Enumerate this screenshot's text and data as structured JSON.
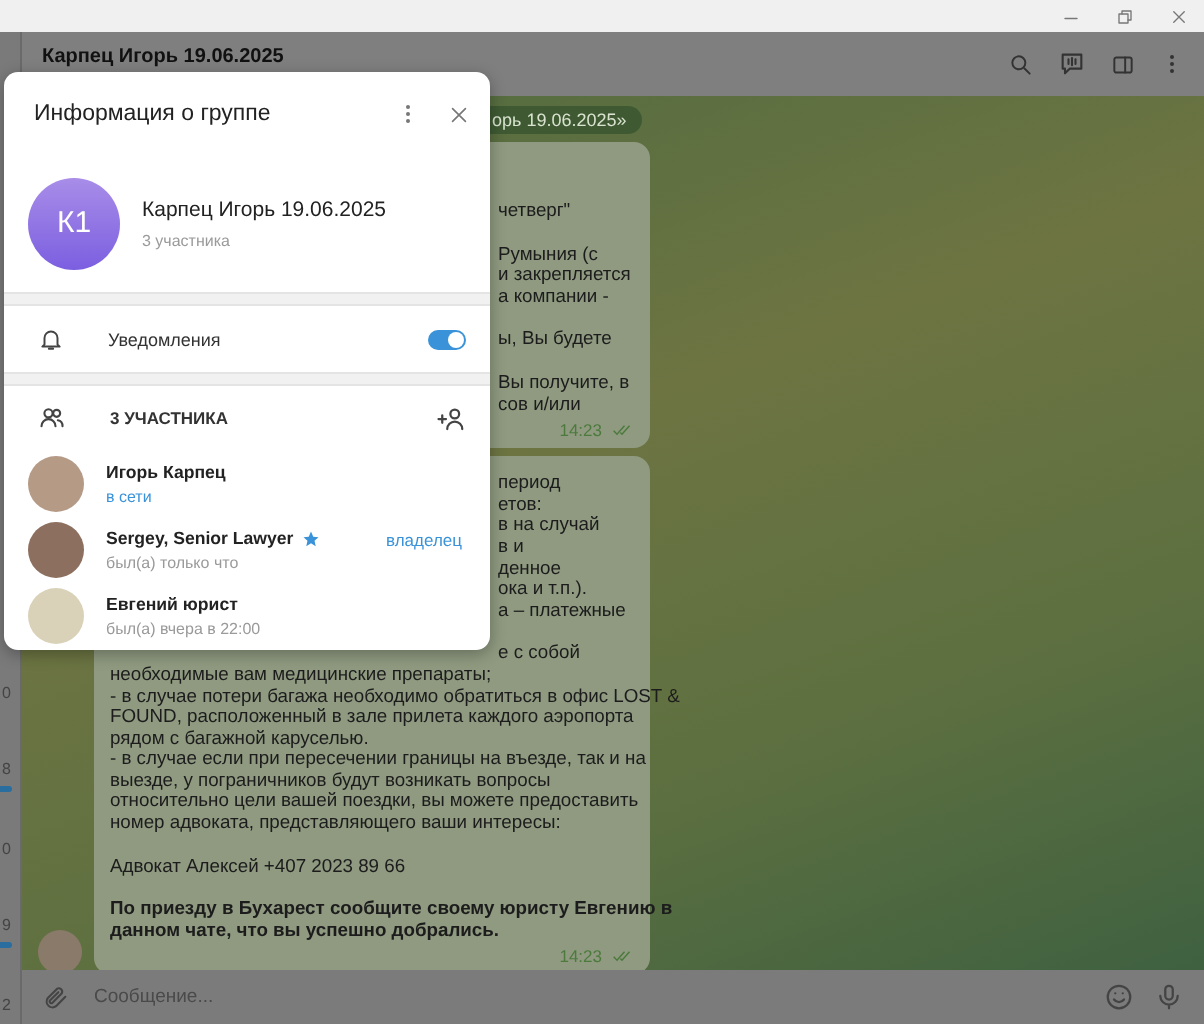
{
  "chat_header": {
    "title": "Карпец Игорь 19.06.2025"
  },
  "sidebar": {
    "items": [
      {
        "text": "0",
        "unread": false
      },
      {
        "text": "8",
        "unread": true
      },
      {
        "text": "0",
        "unread": false
      },
      {
        "text": "9",
        "unread": true
      },
      {
        "text": "2",
        "unread": false
      }
    ]
  },
  "service_message": "орь 19.06.2025»",
  "messages": [
    {
      "time": "14:23",
      "read": true,
      "avatar": false,
      "paragraphs": [
        {
          "bold": false,
          "lines": [
            {
              "text": "четверг\"",
              "clipped": true
            }
          ]
        },
        {
          "bold": false,
          "lines": [
            {
              "text": "Румыния (с",
              "clipped": true
            },
            {
              "text": "и закрепляется",
              "clipped": true
            },
            {
              "text": "а компании -",
              "clipped": true
            }
          ]
        },
        {
          "bold": false,
          "lines": [
            {
              "text": "ы, Вы будете",
              "clipped": true
            }
          ]
        },
        {
          "bold": false,
          "lines": [
            {
              "text": "Вы получите, в",
              "clipped": true
            },
            {
              "text": "сов и/или",
              "clipped": true
            }
          ]
        }
      ]
    },
    {
      "time": "14:23",
      "read": true,
      "avatar": true,
      "paragraphs": [
        {
          "bold": false,
          "lines": [
            {
              "text": "период",
              "clipped": true
            },
            {
              "text": "етов:",
              "clipped": true
            },
            {
              "text": "в на случай",
              "clipped": true
            },
            {
              "text": "в и",
              "clipped": true
            },
            {
              "text": "денное",
              "clipped": true
            },
            {
              "text": "ока и т.п.).",
              "clipped": true
            },
            {
              "text": "а – платежные",
              "clipped": true
            }
          ]
        },
        {
          "bold": false,
          "lines": [
            {
              "text": "е с собой",
              "clipped": true
            },
            {
              "text": "необходимые вам медицинские препараты;",
              "clipped": false
            },
            {
              "text": "- в случае потери багажа необходимо обратиться в офис LOST &",
              "clipped": false
            },
            {
              "text": "FOUND, расположенный в зале прилета каждого аэропорта",
              "clipped": false
            },
            {
              "text": "рядом с багажной каруселью.",
              "clipped": false
            },
            {
              "text": "- в случае если при пересечении границы на въезде, так и на",
              "clipped": false
            },
            {
              "text": "выезде, у пограничников будут возникать вопросы",
              "clipped": false
            },
            {
              "text": "относительно цели вашей поездки, вы можете предоставить",
              "clipped": false
            },
            {
              "text": "номер адвоката, представляющего ваши интересы:",
              "clipped": false
            }
          ]
        },
        {
          "bold": false,
          "lines": [
            {
              "text": "Адвокат Алексей +407 2023 89 66",
              "clipped": false
            }
          ]
        },
        {
          "bold": true,
          "lines": [
            {
              "text": "По приезду в Бухарест сообщите своему юристу Евгению в",
              "clipped": false
            },
            {
              "text": "данном чате, что вы успешно добрались.",
              "clipped": false
            }
          ]
        }
      ]
    }
  ],
  "composer": {
    "placeholder": "Сообщение..."
  },
  "group_info": {
    "title": "Информация о группе",
    "avatar_initials": "К1",
    "name": "Карпец Игорь 19.06.2025",
    "subtitle": "3 участника",
    "notifications": {
      "label": "Уведомления",
      "on": true
    },
    "members_header": "3 УЧАСТНИКА",
    "members": [
      {
        "name": "Игорь Карпец",
        "status": "в сети",
        "online": true,
        "star": false
      },
      {
        "name": "Sergey, Senior Lawyer",
        "status": "был(а) только что",
        "online": false,
        "star": true,
        "role": "владелец"
      },
      {
        "name": "Евгений юрист",
        "status": "был(а) вчера в 22:00",
        "online": false,
        "star": false
      }
    ]
  }
}
